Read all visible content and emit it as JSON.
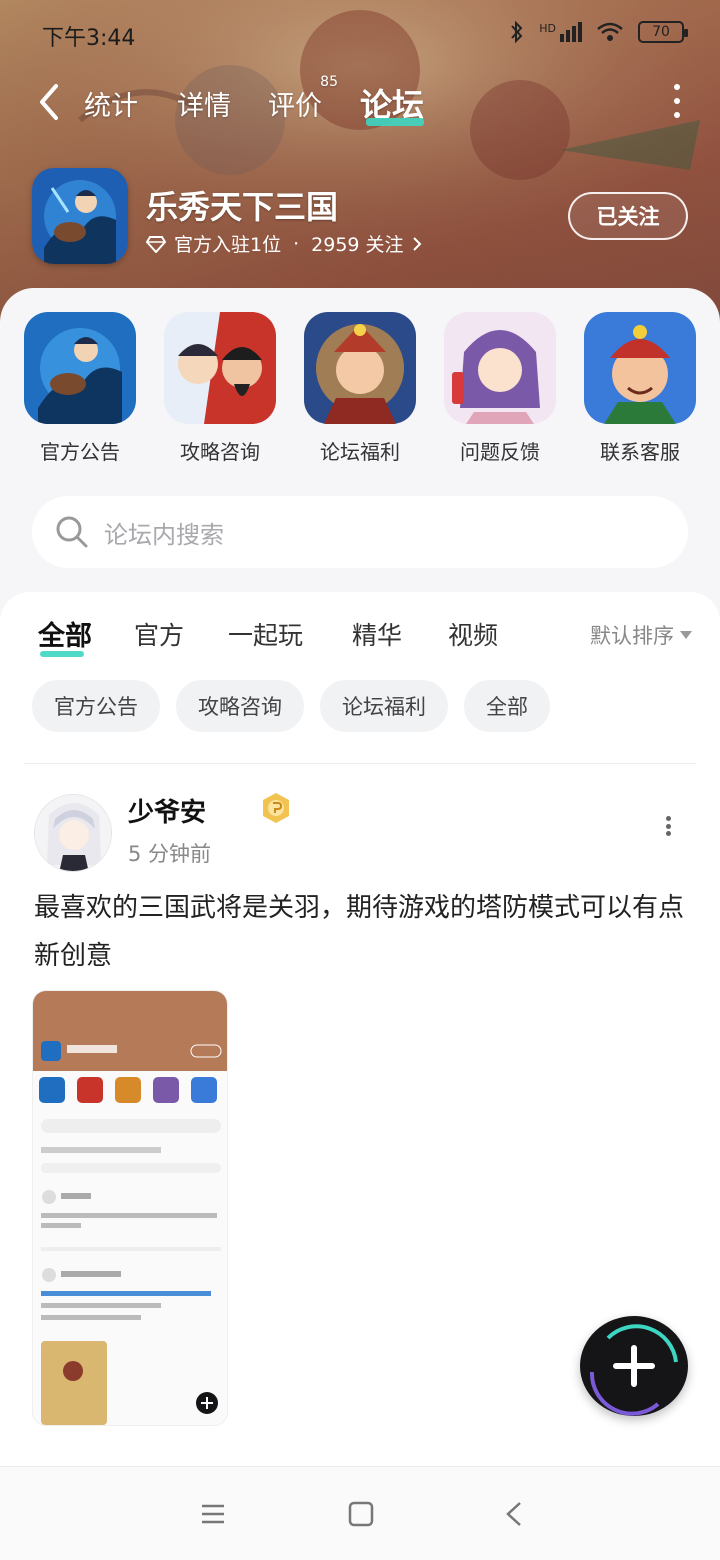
{
  "status_bar": {
    "time": "下午3:44",
    "network": "HD",
    "battery": "70"
  },
  "nav": {
    "tabs": [
      {
        "label": "统计"
      },
      {
        "label": "详情"
      },
      {
        "label": "评价",
        "badge": "85"
      },
      {
        "label": "论坛",
        "active": true
      }
    ]
  },
  "game": {
    "title": "乐秀天下三国",
    "officials": "官方入驻1位",
    "separator": "·",
    "followers": "2959 关注",
    "follow_button": "已关注"
  },
  "shortcuts": [
    {
      "label": "官方公告"
    },
    {
      "label": "攻略咨询"
    },
    {
      "label": "论坛福利"
    },
    {
      "label": "问题反馈"
    },
    {
      "label": "联系客服"
    }
  ],
  "search": {
    "placeholder": "论坛内搜索"
  },
  "feed": {
    "tabs": [
      {
        "label": "全部",
        "active": true
      },
      {
        "label": "官方"
      },
      {
        "label": "一起玩"
      },
      {
        "label": "精华"
      },
      {
        "label": "视频"
      }
    ],
    "sort_label": "默认排序",
    "chips": [
      "官方公告",
      "攻略咨询",
      "论坛福利",
      "全部"
    ]
  },
  "post": {
    "author": "少爷安",
    "time": "5 分钟前",
    "text": "最喜欢的三国武将是关羽，期待游戏的塔防模式可以有点新创意"
  },
  "colors": {
    "accent": "#3cd6c2",
    "hero_bg": "#b57a58",
    "fab_bg": "#151518"
  }
}
